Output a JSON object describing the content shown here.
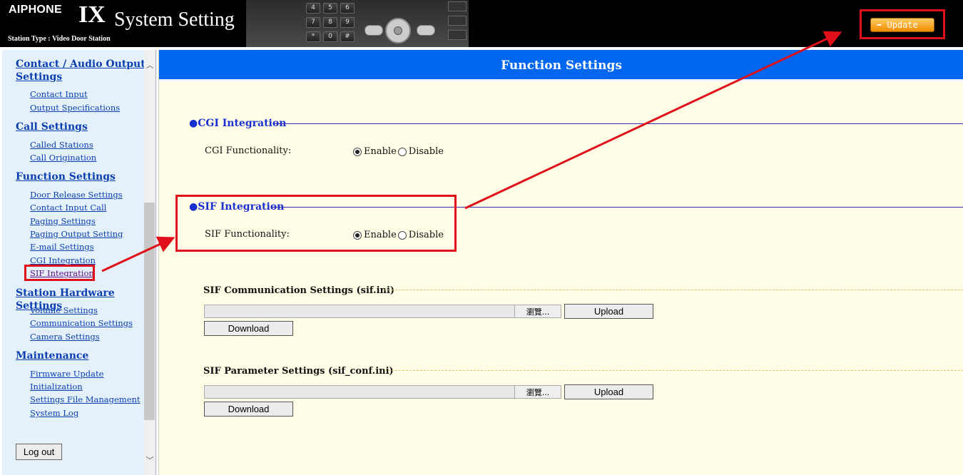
{
  "header": {
    "brand": "AIPHONE",
    "product_big": "IX",
    "product_rest": "System Setting",
    "station_type": "Station Type : Video Door Station",
    "update_label": "Update",
    "update_icon": "arrow-right-icon"
  },
  "sidebar": {
    "sections": [
      {
        "title_line1": "Contact / Audio Output",
        "title_line2": "Settings",
        "items": [
          "Contact Input",
          "Output Specifications"
        ]
      },
      {
        "title": "Call Settings",
        "items": [
          "Called Stations",
          "Call Origination"
        ]
      },
      {
        "title": "Function Settings",
        "items": [
          "Door Release Settings",
          "Contact Input Call",
          "Paging Settings",
          "Paging Output Setting",
          "E-mail Settings",
          "CGI Integration",
          "SIF Integration"
        ]
      },
      {
        "title": "Station Hardware Settings",
        "items": [
          "Volume Settings",
          "Communication Settings",
          "Camera Settings"
        ]
      },
      {
        "title": "Maintenance",
        "items": [
          "Firmware Update",
          "Initialization",
          "Settings File Management",
          "System Log"
        ]
      }
    ],
    "logout_label": "Log out"
  },
  "main": {
    "title": "Function Settings",
    "cgi": {
      "heading": "●CGI Integration",
      "field_label": "CGI Functionality:",
      "options": [
        "Enable",
        "Disable"
      ],
      "selected": "Enable"
    },
    "sif": {
      "heading": "●SIF Integration",
      "field_label": "SIF Functionality:",
      "options": [
        "Enable",
        "Disable"
      ],
      "selected": "Enable"
    },
    "sif_comm": {
      "heading": "SIF Communication Settings (sif.ini)",
      "browse_label": "瀏覽...",
      "upload_label": "Upload",
      "download_label": "Download"
    },
    "sif_param": {
      "heading": "SIF Parameter Settings (sif_conf.ini)",
      "browse_label": "瀏覽...",
      "upload_label": "Upload",
      "download_label": "Download"
    }
  },
  "colors": {
    "title_bar": "#0066ee",
    "link": "#0b3fb0",
    "highlight": "#e0101a",
    "update_button": "#f08c00"
  }
}
